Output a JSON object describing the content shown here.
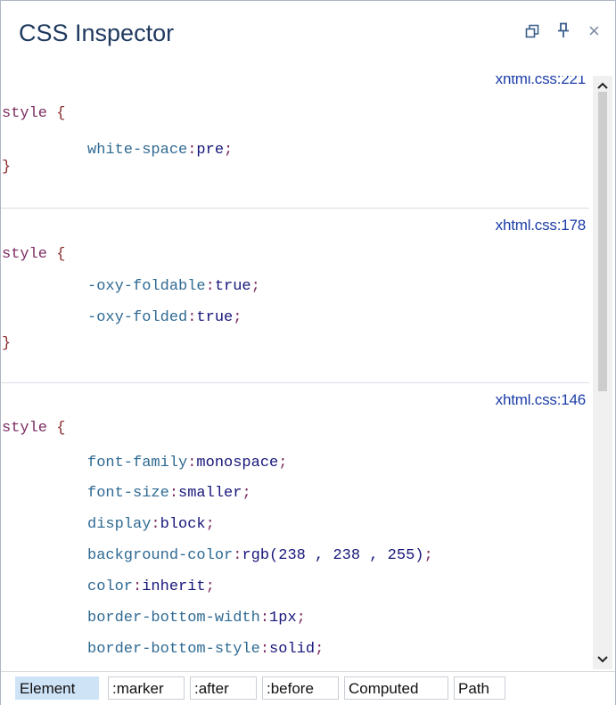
{
  "window": {
    "title": "CSS Inspector",
    "controls": {
      "restore": "🗗",
      "pin": "⊣",
      "close": "×"
    }
  },
  "rules": [
    {
      "source": "xhtml.css:221",
      "selector": "style",
      "open": "{",
      "close": "}",
      "declarations": [
        {
          "prop": "white-space",
          "value": "pre"
        }
      ]
    },
    {
      "source": "xhtml.css:178",
      "selector": "style",
      "open": "{",
      "close": "}",
      "declarations": [
        {
          "prop": "-oxy-foldable",
          "value": "true"
        },
        {
          "prop": "-oxy-folded",
          "value": "true"
        }
      ]
    },
    {
      "source": "xhtml.css:146",
      "selector": "style",
      "open": "{",
      "declarations": [
        {
          "prop": "font-family",
          "value": "monospace"
        },
        {
          "prop": "font-size",
          "value": "smaller"
        },
        {
          "prop": "display",
          "value": "block"
        },
        {
          "prop": "background-color",
          "value": "rgb(238 , 238 , 255)"
        },
        {
          "prop": "color",
          "value": "inherit"
        },
        {
          "prop": "border-bottom-width",
          "value": "1px"
        },
        {
          "prop": "border-bottom-style",
          "value": "solid"
        }
      ]
    }
  ],
  "punct": {
    "colon": ":",
    "semicolon": ";"
  },
  "scrollbar": {
    "up": "^",
    "down": "v"
  },
  "tabs": [
    {
      "label": "Element",
      "active": true
    },
    {
      "label": ":marker",
      "active": false
    },
    {
      "label": ":after",
      "active": false
    },
    {
      "label": ":before",
      "active": false
    },
    {
      "label": "Computed",
      "active": false
    },
    {
      "label": "Path",
      "active": false
    }
  ],
  "colors": {
    "title": "#1f3a5f",
    "link": "#1d3ea8",
    "selector": "#7b2d62",
    "property": "#2f6a93",
    "value": "#17167a",
    "active_tab": "#cfe3f7"
  }
}
